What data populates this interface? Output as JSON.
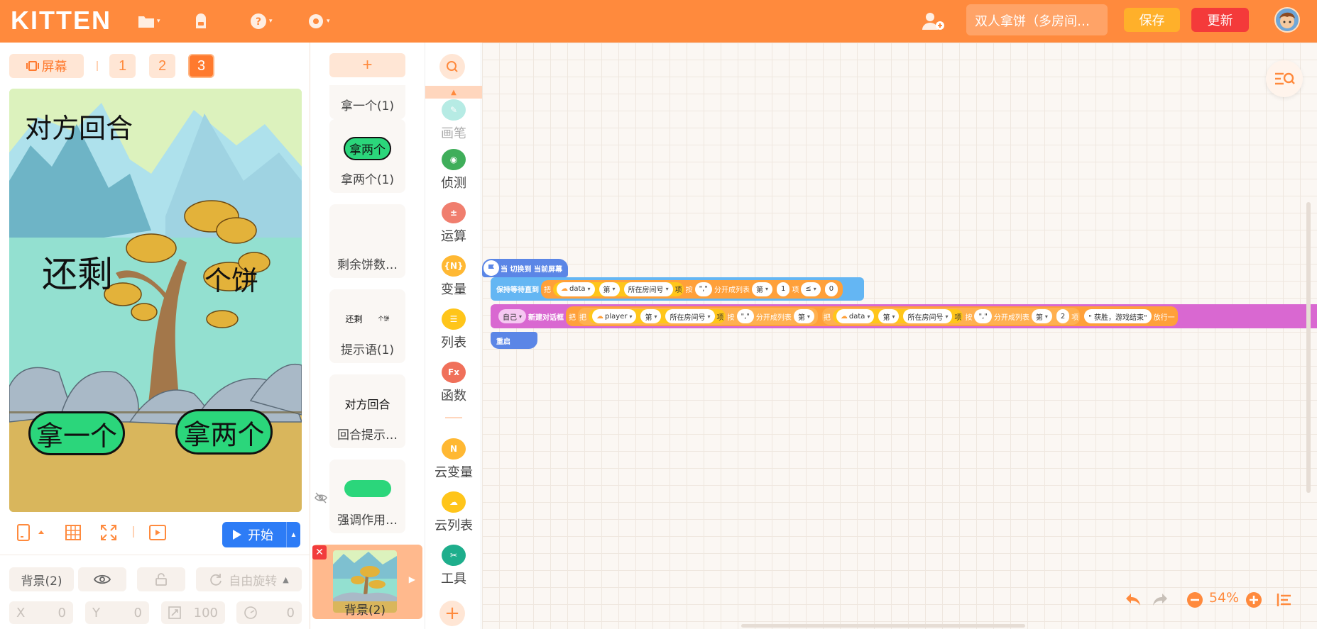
{
  "topbar": {
    "logo": "KITTEN",
    "project_title": "双人拿饼（多房间联…",
    "save_label": "保存",
    "update_label": "更新",
    "icons": [
      "folder-icon",
      "backpack-icon",
      "help-icon",
      "gear-icon",
      "add-user-icon"
    ]
  },
  "stage_panel": {
    "screen_label": "屏幕",
    "pages": [
      "1",
      "2",
      "3"
    ],
    "active_page": "3",
    "stage_texts": {
      "turn": "对方回合",
      "remaining": "还剩",
      "unit": "个饼",
      "take_one": "拿一个",
      "take_two": "拿两个"
    },
    "start_label": "开始",
    "props": {
      "sprite_name": "背景(2)",
      "rotation_mode": "自由旋转",
      "x_label": "X",
      "x_value": "0",
      "y_label": "Y",
      "y_value": "0",
      "size_value": "100",
      "direction_value": "0"
    }
  },
  "sprite_list": {
    "add_label": "+",
    "cards": [
      {
        "name": "拿一个(1)",
        "thumb_text": ""
      },
      {
        "name": "拿两个(1)",
        "thumb_text": "拿两个"
      },
      {
        "name": "剩余饼数…",
        "thumb_text": ""
      },
      {
        "name": "提示语(1)",
        "thumb_text": "还剩",
        "thumb_text2": "个饼"
      },
      {
        "name": "回合提示…",
        "thumb_text": "对方回合"
      },
      {
        "name": "强调作用…",
        "thumb_text": ""
      }
    ],
    "background_card": {
      "name": "背景(2)"
    }
  },
  "palette": {
    "categories": [
      {
        "label": "画笔",
        "color": "#5fd3c4",
        "icon": "pen-icon"
      },
      {
        "label": "侦测",
        "color": "#3fae5a",
        "icon": "sensing-icon"
      },
      {
        "label": "运算",
        "color": "#f07e6e",
        "icon": "operator-icon"
      },
      {
        "label": "变量",
        "color": "#ffb833",
        "icon": "variable-icon",
        "glyph": "{N}"
      },
      {
        "label": "列表",
        "color": "#ffc51a",
        "icon": "list-icon"
      },
      {
        "label": "函数",
        "color": "#f0705a",
        "icon": "function-icon",
        "glyph": "Fx"
      },
      {
        "label": "云变量",
        "color": "#ffb833",
        "icon": "cloud-variable-icon",
        "glyph": "N"
      },
      {
        "label": "云列表",
        "color": "#ffc51a",
        "icon": "cloud-list-icon"
      },
      {
        "label": "工具",
        "color": "#1eae8c",
        "icon": "tools-icon"
      }
    ]
  },
  "workspace": {
    "hat_block": "当 切换到 当前屏幕",
    "wait_block": {
      "label": "保持等待直到",
      "take": "把",
      "var": "data",
      "nth": "第",
      "room": "所在房间号",
      "item": "项",
      "by": "按",
      "sep": "\",\"",
      "split": "分开成列表",
      "index": "1",
      "op": "≤",
      "value": "0"
    },
    "dialog_block": {
      "self": "自己",
      "label": "新建对话框",
      "take": "把",
      "var1": "player",
      "nth": "第",
      "room": "所在房间号",
      "item": "项",
      "by": "按",
      "sep": "\",\"",
      "split": "分开成列表",
      "var2": "data",
      "index": "2",
      "message": "\" 获胜，游戏结束\"",
      "tail": "放行一"
    },
    "restart_block": "重启",
    "zoom": "54%"
  }
}
